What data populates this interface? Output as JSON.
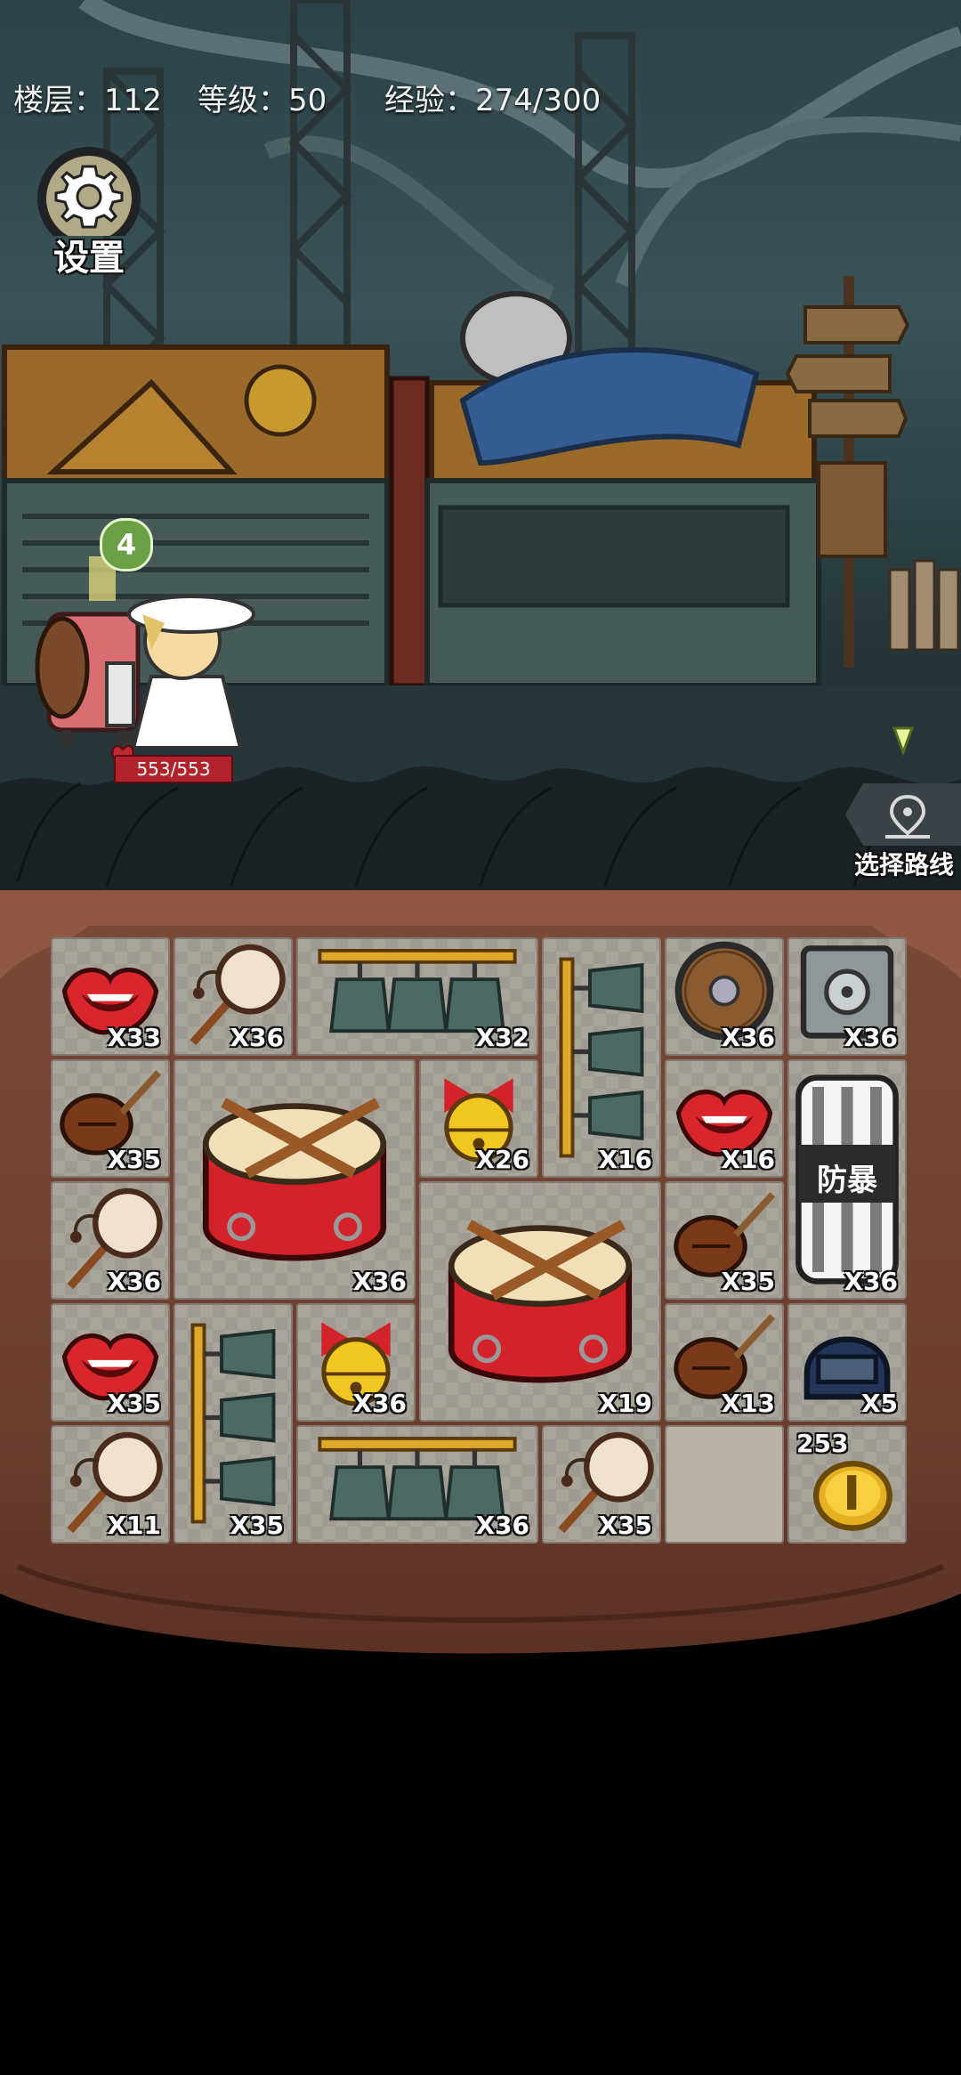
{
  "hud": {
    "floor": "楼层：112",
    "level": "等级：50",
    "exp": "经验：274/300"
  },
  "settings_label": "设置",
  "route_label": "选择路线",
  "player": {
    "level_badge": "4",
    "hp_text": "553/553"
  },
  "inventory": {
    "items": [
      {
        "name": "lips-item",
        "icon": "lips-icon",
        "qty": "X33",
        "col": 0,
        "row": 0,
        "w": 1,
        "h": 1
      },
      {
        "name": "rattle-drum-item",
        "icon": "rattle-drum-icon",
        "qty": "X36",
        "col": 1,
        "row": 0,
        "w": 1,
        "h": 1
      },
      {
        "name": "bronze-bells-item",
        "icon": "bells-horizontal-icon",
        "qty": "X32",
        "col": 2,
        "row": 0,
        "w": 2,
        "h": 1
      },
      {
        "name": "bronze-bells-vertical-item",
        "icon": "bells-vertical-icon",
        "qty": "X16",
        "col": 4,
        "row": 0,
        "w": 1,
        "h": 2
      },
      {
        "name": "round-shield-item",
        "icon": "round-shield-icon",
        "qty": "X36",
        "col": 5,
        "row": 0,
        "w": 1,
        "h": 1
      },
      {
        "name": "safe-item",
        "icon": "safe-icon",
        "qty": "X36",
        "col": 6,
        "row": 0,
        "w": 1,
        "h": 1
      },
      {
        "name": "pipa-item",
        "icon": "pipa-icon",
        "qty": "X35",
        "col": 0,
        "row": 1,
        "w": 1,
        "h": 1
      },
      {
        "name": "big-drum-item",
        "icon": "drum-icon",
        "qty": "X36",
        "col": 1,
        "row": 1,
        "w": 2,
        "h": 2
      },
      {
        "name": "golden-bell-item",
        "icon": "golden-bell-icon",
        "qty": "X26",
        "col": 3,
        "row": 1,
        "w": 1,
        "h": 1
      },
      {
        "name": "lips-item",
        "icon": "lips-icon",
        "qty": "X16",
        "col": 5,
        "row": 1,
        "w": 1,
        "h": 1
      },
      {
        "name": "riot-shield-item",
        "icon": "riot-shield-icon",
        "qty": "X36",
        "col": 6,
        "row": 1,
        "w": 1,
        "h": 2,
        "text": "防暴"
      },
      {
        "name": "rattle-drum-item",
        "icon": "rattle-drum-icon",
        "qty": "X36",
        "col": 0,
        "row": 2,
        "w": 1,
        "h": 1
      },
      {
        "name": "big-drum-item",
        "icon": "drum-icon",
        "qty": "X19",
        "col": 3,
        "row": 2,
        "w": 2,
        "h": 2
      },
      {
        "name": "pipa-item",
        "icon": "pipa-icon",
        "qty": "X35",
        "col": 5,
        "row": 2,
        "w": 1,
        "h": 1
      },
      {
        "name": "lips-item",
        "icon": "lips-icon",
        "qty": "X35",
        "col": 0,
        "row": 3,
        "w": 1,
        "h": 1
      },
      {
        "name": "bronze-bells-vertical-item",
        "icon": "bells-vertical-icon",
        "qty": "X35",
        "col": 1,
        "row": 3,
        "w": 1,
        "h": 2
      },
      {
        "name": "golden-bell-item",
        "icon": "golden-bell-icon",
        "qty": "X36",
        "col": 2,
        "row": 3,
        "w": 1,
        "h": 1
      },
      {
        "name": "pipa-item",
        "icon": "pipa-icon",
        "qty": "X13",
        "col": 5,
        "row": 3,
        "w": 1,
        "h": 1
      },
      {
        "name": "helmet-item",
        "icon": "helmet-icon",
        "qty": "X5",
        "col": 6,
        "row": 3,
        "w": 1,
        "h": 1
      },
      {
        "name": "rattle-drum-item",
        "icon": "rattle-drum-icon",
        "qty": "X11",
        "col": 0,
        "row": 4,
        "w": 1,
        "h": 1
      },
      {
        "name": "bronze-bells-item",
        "icon": "bells-horizontal-icon",
        "qty": "X36",
        "col": 2,
        "row": 4,
        "w": 2,
        "h": 1
      },
      {
        "name": "rattle-drum-item",
        "icon": "rattle-drum-icon",
        "qty": "X35",
        "col": 4,
        "row": 4,
        "w": 1,
        "h": 1
      },
      {
        "name": "empty-slot",
        "icon": "",
        "qty": "",
        "col": 5,
        "row": 4,
        "w": 1,
        "h": 1
      },
      {
        "name": "coin-item",
        "icon": "coin-icon",
        "qty": "253",
        "qty_pos": "top",
        "col": 6,
        "row": 4,
        "w": 1,
        "h": 1
      }
    ]
  }
}
